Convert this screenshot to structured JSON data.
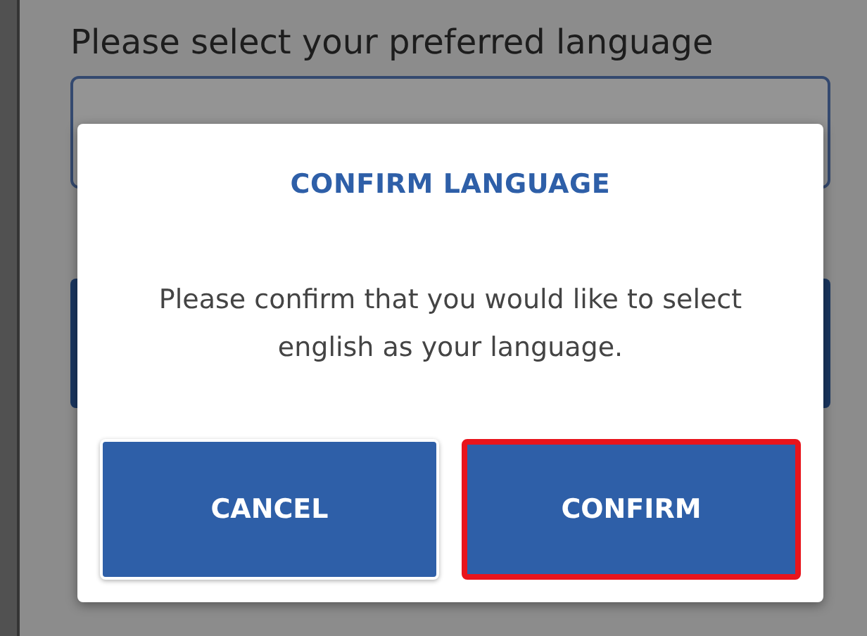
{
  "page": {
    "prompt": "Please select your preferred language"
  },
  "dialog": {
    "title": "CONFIRM LANGUAGE",
    "message": "Please confirm that you would like to select english as your language.",
    "buttons": [
      {
        "label": "CANCEL",
        "highlighted": false
      },
      {
        "label": "CONFIRM",
        "highlighted": true
      }
    ]
  }
}
